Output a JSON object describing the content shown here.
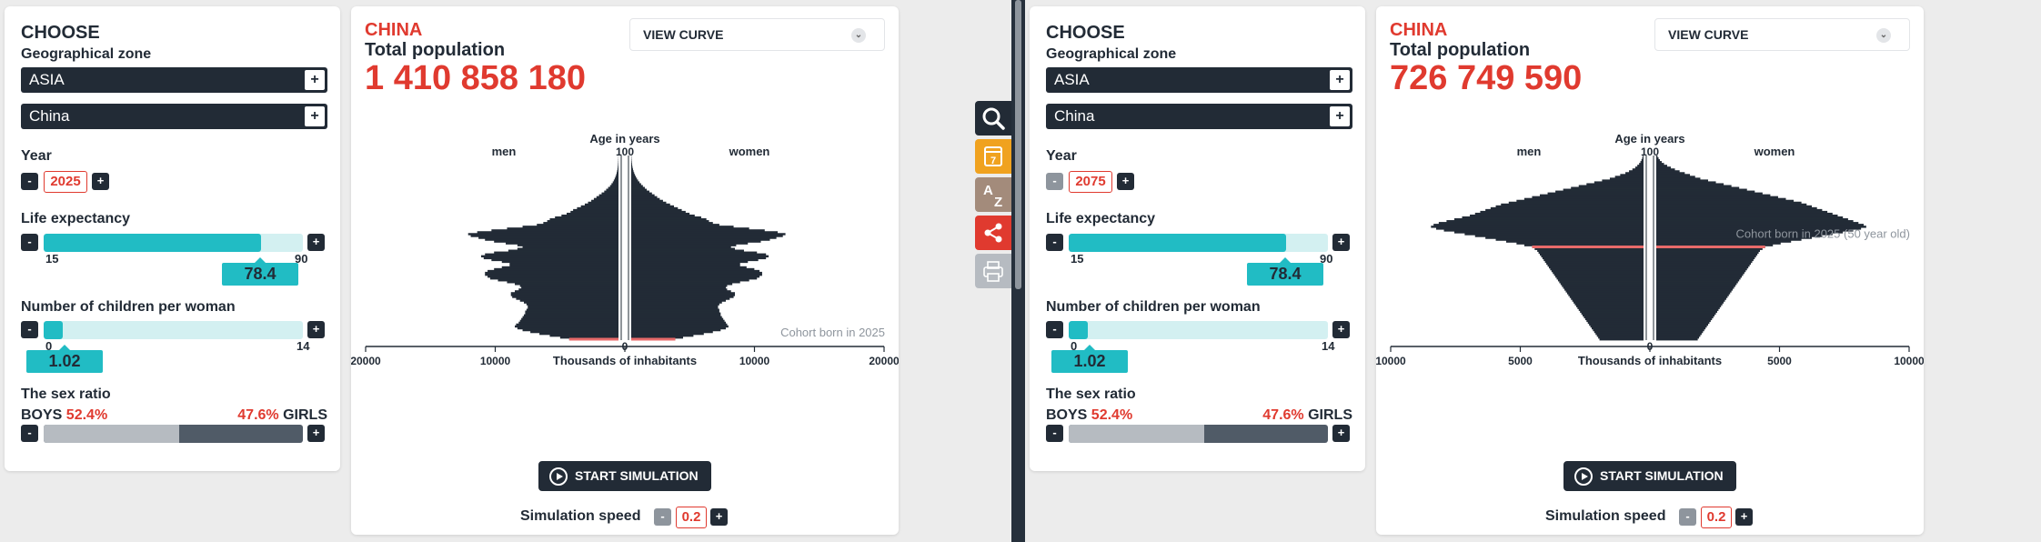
{
  "panels": [
    {
      "choose_title": "CHOOSE",
      "zone_label": "Geographical zone",
      "region": "ASIA",
      "country_select": "China",
      "year_label": "Year",
      "year": "2025",
      "life_label": "Life expectancy",
      "life_min": "15",
      "life_max": "90",
      "life_value": "78.4",
      "life_fraction": 0.84,
      "children_label": "Number of children per woman",
      "children_min": "0",
      "children_max": "14",
      "children_value": "1.02",
      "children_fraction": 0.073,
      "sex_label": "The sex ratio",
      "boys_label": "BOYS",
      "boys_pct": "52.4%",
      "girls_pct": "47.6%",
      "girls_label": "GIRLS",
      "boys_fraction": 0.524,
      "country_title": "CHINA",
      "total_label": "Total population",
      "total_value": "1 410 858 180",
      "view_curve": "VIEW CURVE",
      "start_label": "START SIMULATION",
      "speed_label": "Simulation speed",
      "speed_value": "0.2",
      "year_minus_disabled": false
    },
    {
      "choose_title": "CHOOSE",
      "zone_label": "Geographical zone",
      "region": "ASIA",
      "country_select": "China",
      "year_label": "Year",
      "year": "2075",
      "life_label": "Life expectancy",
      "life_min": "15",
      "life_max": "90",
      "life_value": "78.4",
      "life_fraction": 0.84,
      "children_label": "Number of children per woman",
      "children_min": "0",
      "children_max": "14",
      "children_value": "1.02",
      "children_fraction": 0.073,
      "sex_label": "The sex ratio",
      "boys_label": "BOYS",
      "boys_pct": "52.4%",
      "girls_pct": "47.6%",
      "girls_label": "GIRLS",
      "boys_fraction": 0.524,
      "country_title": "CHINA",
      "total_label": "Total population",
      "total_value": "726 749 590",
      "view_curve": "VIEW CURVE",
      "start_label": "START SIMULATION",
      "speed_label": "Simulation speed",
      "speed_value": "0.2",
      "year_minus_disabled": true
    }
  ],
  "toolbar": {
    "items": [
      {
        "icon": "search-icon",
        "color": "#222b36"
      },
      {
        "icon": "calendar-icon",
        "color": "#f0a21f"
      },
      {
        "icon": "sort-az-icon",
        "color": "#a38b7b"
      },
      {
        "icon": "share-icon",
        "color": "#e03a2f"
      },
      {
        "icon": "print-icon",
        "color": "#b6bbc1"
      }
    ]
  },
  "chart_data": [
    {
      "type": "population-pyramid",
      "title": "Age in years",
      "left_label": "men",
      "right_label": "women",
      "age_top_label": "100",
      "x_axis_label": "Thousands of inhabitants",
      "x_ticks_left": [
        "20000",
        "10000"
      ],
      "x_ticks_right": [
        "10000",
        "20000"
      ],
      "x_zero": "0",
      "x_max": 20000,
      "age_max": 100,
      "cohort_label": "Cohort born in 2025",
      "cohort_age": 0,
      "men": [
        3800,
        4500,
        5300,
        6100,
        6800,
        7400,
        7800,
        8000,
        7900,
        7700,
        7600,
        7500,
        7400,
        7300,
        7200,
        7200,
        7100,
        7000,
        7000,
        7100,
        7300,
        7600,
        7900,
        8200,
        8300,
        8300,
        8000,
        7700,
        7500,
        7600,
        8000,
        8600,
        9300,
        9900,
        10100,
        10300,
        10300,
        10100,
        9600,
        9000,
        8400,
        8400,
        9000,
        9800,
        10400,
        10600,
        10300,
        9600,
        8500,
        7800,
        7400,
        7800,
        8700,
        9600,
        10300,
        10800,
        11400,
        11600,
        10900,
        9800,
        8600,
        7400,
        6300,
        5800,
        5500,
        5300,
        4900,
        4400,
        4000,
        3700,
        3500,
        3200,
        2900,
        2600,
        2350,
        2100,
        1900,
        1700,
        1500,
        1300,
        1100,
        950,
        800,
        650,
        540,
        440,
        360,
        290,
        230,
        180,
        140,
        110,
        80,
        60,
        45,
        35,
        25,
        18,
        12,
        8
      ],
      "women": [
        3400,
        4000,
        4800,
        5600,
        6300,
        6900,
        7300,
        7500,
        7400,
        7300,
        7200,
        7100,
        7000,
        6900,
        6900,
        6800,
        6800,
        6700,
        6700,
        6800,
        7000,
        7300,
        7600,
        7900,
        8000,
        8000,
        7700,
        7400,
        7300,
        7400,
        7800,
        8400,
        9100,
        9700,
        9900,
        10100,
        10100,
        9900,
        9500,
        8900,
        8400,
        8400,
        9000,
        9800,
        10400,
        10600,
        10400,
        9700,
        8700,
        8000,
        7700,
        8100,
        9000,
        10000,
        10700,
        11200,
        11700,
        11900,
        11300,
        10300,
        9100,
        7900,
        6800,
        6300,
        6000,
        5800,
        5400,
        4900,
        4500,
        4200,
        3900,
        3600,
        3300,
        3000,
        2700,
        2450,
        2200,
        2000,
        1800,
        1600,
        1400,
        1200,
        1050,
        900,
        760,
        640,
        530,
        440,
        360,
        290,
        230,
        180,
        140,
        105,
        80,
        60,
        45,
        32,
        22,
        15
      ]
    },
    {
      "type": "population-pyramid",
      "title": "Age in years",
      "left_label": "men",
      "right_label": "women",
      "age_top_label": "100",
      "x_axis_label": "Thousands of inhabitants",
      "x_ticks_left": [
        "10000",
        "5000"
      ],
      "x_ticks_right": [
        "5000",
        "10000"
      ],
      "x_zero": "0",
      "x_max": 10000,
      "age_max": 100,
      "cohort_label": "Cohort born in 2025 (50 year old)",
      "cohort_age": 50,
      "men": [
        1700,
        1750,
        1800,
        1850,
        1900,
        1950,
        2000,
        2050,
        2100,
        2150,
        2200,
        2250,
        2300,
        2350,
        2400,
        2450,
        2500,
        2550,
        2600,
        2650,
        2700,
        2750,
        2800,
        2850,
        2900,
        2950,
        3000,
        3050,
        3100,
        3150,
        3200,
        3250,
        3300,
        3350,
        3400,
        3450,
        3500,
        3550,
        3600,
        3650,
        3700,
        3750,
        3800,
        3850,
        3900,
        3950,
        4000,
        4050,
        4100,
        4200,
        4300,
        4600,
        4900,
        5300,
        5700,
        6100,
        6500,
        6900,
        7300,
        7700,
        8000,
        8200,
        8100,
        7900,
        7600,
        7300,
        7000,
        6700,
        6500,
        6300,
        6100,
        5900,
        5700,
        5500,
        5200,
        4900,
        4600,
        4300,
        4000,
        3700,
        3400,
        3100,
        2800,
        2500,
        2200,
        1900,
        1600,
        1300,
        1100,
        900,
        700,
        560,
        430,
        320,
        240,
        170,
        120,
        80,
        50,
        30
      ],
      "women": [
        1600,
        1650,
        1700,
        1750,
        1800,
        1850,
        1900,
        1950,
        2000,
        2050,
        2100,
        2150,
        2200,
        2250,
        2300,
        2350,
        2400,
        2450,
        2500,
        2550,
        2600,
        2650,
        2700,
        2750,
        2800,
        2850,
        2900,
        2950,
        3000,
        3050,
        3100,
        3150,
        3200,
        3250,
        3300,
        3350,
        3400,
        3450,
        3500,
        3550,
        3600,
        3650,
        3700,
        3750,
        3800,
        3850,
        3900,
        3950,
        4000,
        4100,
        4200,
        4500,
        4800,
        5200,
        5600,
        6000,
        6400,
        6800,
        7200,
        7600,
        7900,
        8100,
        8000,
        7800,
        7600,
        7400,
        7200,
        7000,
        6800,
        6600,
        6400,
        6200,
        6000,
        5800,
        5600,
        5300,
        5000,
        4700,
        4400,
        4100,
        3800,
        3500,
        3200,
        2900,
        2600,
        2300,
        2000,
        1700,
        1500,
        1300,
        1100,
        900,
        720,
        560,
        420,
        300,
        210,
        140,
        90,
        50
      ]
    }
  ]
}
